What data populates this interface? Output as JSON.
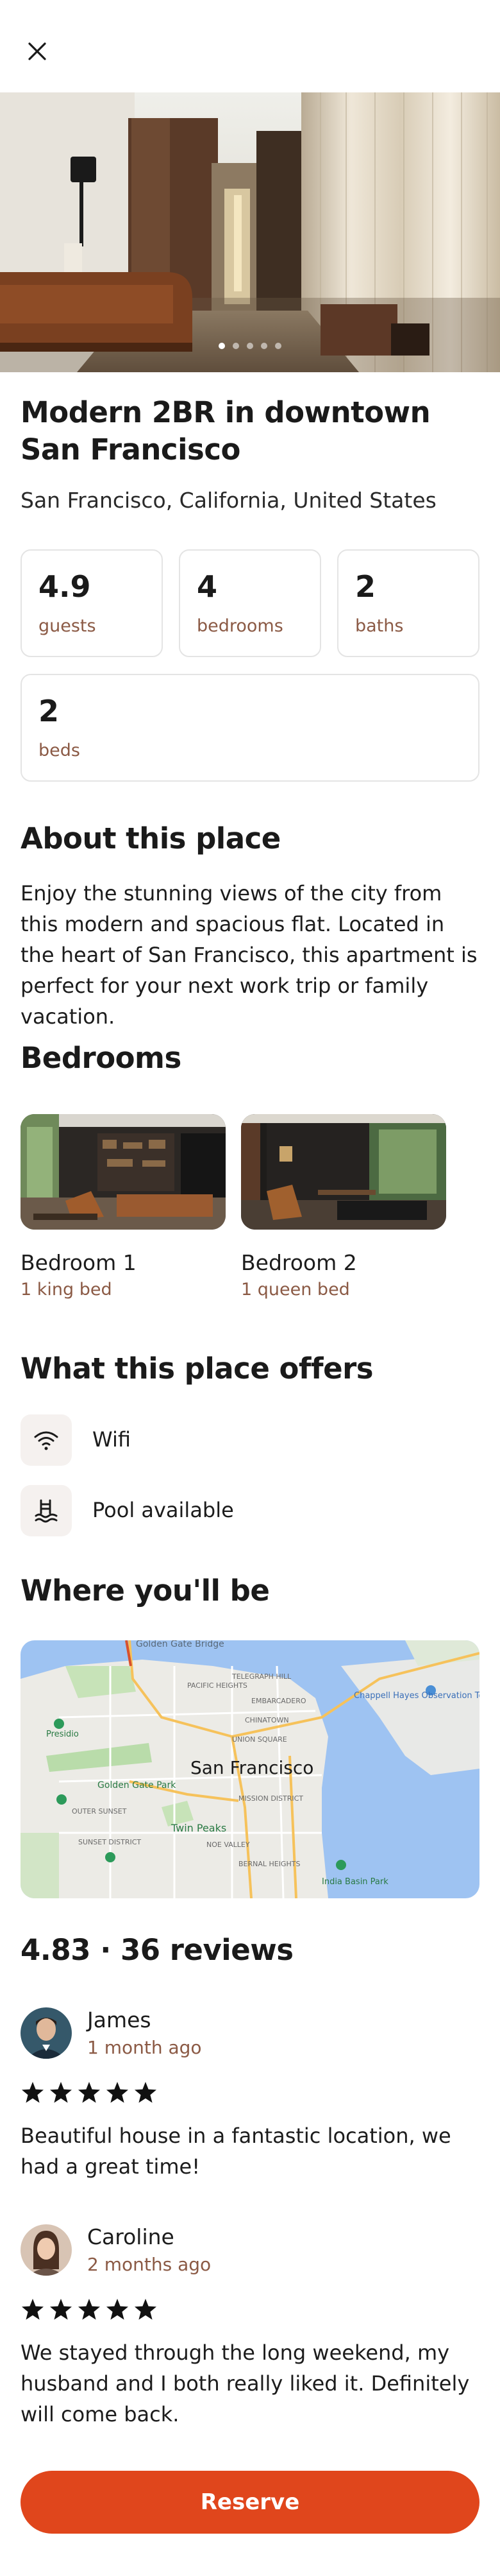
{
  "theme": {
    "accent": "#e0461c",
    "label_brown": "#8b5a45",
    "card_border": "#e4e4e4"
  },
  "header": {
    "close_icon": "close-icon"
  },
  "gallery": {
    "image_count": 5,
    "active_index": 0
  },
  "listing": {
    "title": "Modern 2BR in downtown San Francisco",
    "location": "San Francisco, California, United States"
  },
  "stats": [
    {
      "value": "4.9",
      "label": "guests"
    },
    {
      "value": "4",
      "label": "bedrooms"
    },
    {
      "value": "2",
      "label": "baths"
    },
    {
      "value": "2",
      "label": "beds"
    }
  ],
  "about": {
    "heading": "About this place",
    "text": "Enjoy the stunning views of the city from this modern and spacious flat. Located in the heart of San Francisco, this apartment is perfect for your next work trip or family vacation."
  },
  "bedrooms": {
    "heading": "Bedrooms",
    "items": [
      {
        "name": "Bedroom 1",
        "bed": "1 king bed"
      },
      {
        "name": "Bedroom 2",
        "bed": "1 queen bed"
      }
    ]
  },
  "amenities": {
    "heading": "What this place offers",
    "items": [
      {
        "icon": "wifi-icon",
        "label": "Wifi"
      },
      {
        "icon": "pool-icon",
        "label": "Pool available"
      }
    ]
  },
  "location_section": {
    "heading": "Where you'll be",
    "map": {
      "city_label": "San Francisco",
      "labels": {
        "golden_gate": "Golden Gate Bridge",
        "presidio": "Presidio",
        "golden_gate_park": "Golden Gate Park",
        "outer_sunset": "OUTER SUNSET",
        "twin_peaks": "Twin Peaks",
        "noe_valley": "NOE VALLEY",
        "bernal_heights": "BERNAL HEIGHTS",
        "mission": "MISSION DISTRICT",
        "chinatown": "CHINATOWN",
        "union_square": "UNION SQUARE",
        "pacific_heights": "PACIFIC HEIGHTS",
        "chappell_hayes": "Chappell Hayes Observation Tower",
        "india_basin": "India Basin Park",
        "sunset_district": "SUNSET DISTRICT",
        "embarcadero": "EMBARCADERO",
        "telegraph": "TELEGRAPH HILL"
      }
    }
  },
  "reviews": {
    "summary": "4.83 · 36 reviews",
    "items": [
      {
        "name": "James",
        "time": "1 month ago",
        "rating": 5,
        "text": "Beautiful house in a fantastic location, we had a great time!"
      },
      {
        "name": "Caroline",
        "time": "2 months ago",
        "rating": 5,
        "text": "We stayed through the long weekend, my husband and I both really liked it. Definitely will come back."
      }
    ]
  },
  "cta": {
    "reserve_label": "Reserve"
  }
}
